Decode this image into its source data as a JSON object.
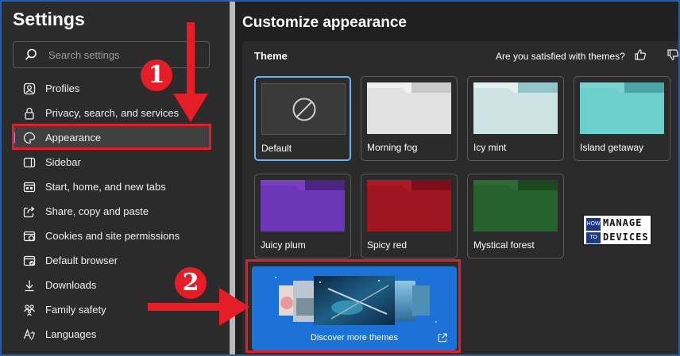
{
  "sidebar": {
    "title": "Settings",
    "search": {
      "placeholder": "Search settings",
      "icon": "search-icon"
    },
    "items": [
      {
        "label": "Profiles",
        "icon": "profile-icon"
      },
      {
        "label": "Privacy, search, and services",
        "icon": "lock-icon"
      },
      {
        "label": "Appearance",
        "icon": "palette-icon",
        "selected": true
      },
      {
        "label": "Sidebar",
        "icon": "sidebar-icon"
      },
      {
        "label": "Start, home, and new tabs",
        "icon": "home-tabs-icon"
      },
      {
        "label": "Share, copy and paste",
        "icon": "share-icon"
      },
      {
        "label": "Cookies and site permissions",
        "icon": "cookies-icon"
      },
      {
        "label": "Default browser",
        "icon": "browser-icon"
      },
      {
        "label": "Downloads",
        "icon": "download-icon"
      },
      {
        "label": "Family safety",
        "icon": "family-icon"
      },
      {
        "label": "Languages",
        "icon": "languages-icon"
      }
    ]
  },
  "main": {
    "title": "Customize appearance",
    "theme": {
      "label": "Theme",
      "feedback_text": "Are you satisfied with themes?",
      "cards": [
        {
          "name": "Default",
          "selected": true,
          "back": "#3a3a3a",
          "tab": "#3a3a3a",
          "body": "#3a3a3a"
        },
        {
          "name": "Morning fog",
          "back": "#f0f0f0",
          "tab": "#c9c9c9",
          "body": "#e1e1e1"
        },
        {
          "name": "Icy mint",
          "back": "#e3f0f0",
          "tab": "#94c6c9",
          "body": "#cde3e4"
        },
        {
          "name": "Island getaway",
          "back": "#7dd2cf",
          "tab": "#4aa6a4",
          "body": "#6ccfcb"
        },
        {
          "name": "Juicy plum",
          "back": "#7a3ec4",
          "tab": "#4f2386",
          "body": "#6c35b8"
        },
        {
          "name": "Spicy red",
          "back": "#b0182a",
          "tab": "#7d0e1a",
          "body": "#a0141f"
        },
        {
          "name": "Mystical forest",
          "back": "#2d6a34",
          "tab": "#1b4a21",
          "body": "#25622c"
        }
      ],
      "discover_label": "Discover more themes"
    }
  },
  "annotations": {
    "step1": "1",
    "step2": "2",
    "color": "#e41d26"
  },
  "logo": {
    "how": "HOW",
    "to": "TO",
    "manage": "MANAGE",
    "devices": "DEVICES"
  },
  "colors": {
    "accent": "#6cb2f3",
    "highlight": "#e41d26",
    "discover_bg": "#1c72d6"
  }
}
